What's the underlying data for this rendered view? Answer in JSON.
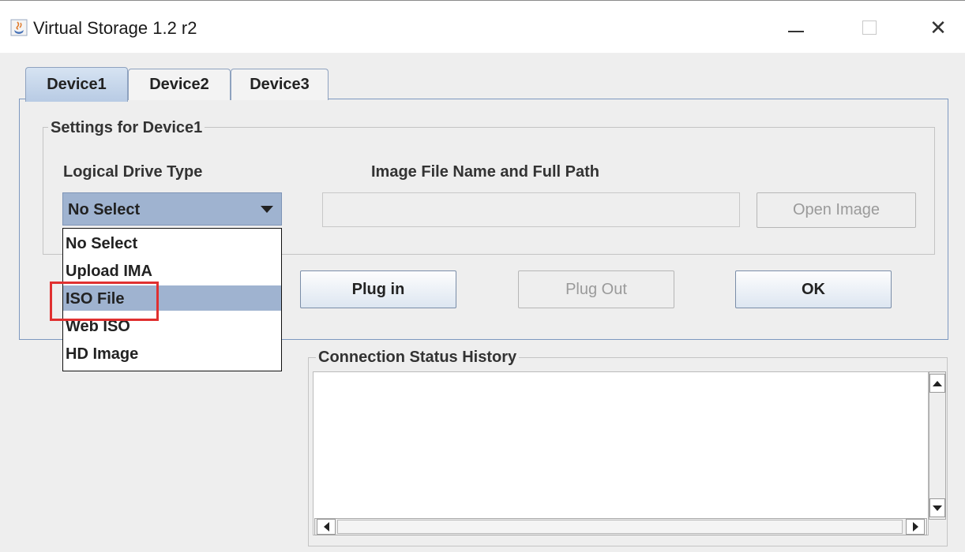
{
  "window": {
    "title": "Virtual Storage 1.2 r2",
    "icon": "java-cup-icon",
    "controls": {
      "minimize": "minimize-icon",
      "maximize": "maximize-icon",
      "close_symbol": "✕"
    }
  },
  "tabs": [
    {
      "label": "Device1",
      "active": true
    },
    {
      "label": "Device2",
      "active": false
    },
    {
      "label": "Device3",
      "active": false
    }
  ],
  "settings": {
    "group_title": "Settings for Device1",
    "drive_type_label": "Logical Drive Type",
    "drive_type_value": "No Select",
    "image_path_label": "Image File Name and Full Path",
    "image_path_value": "",
    "open_image_label": "Open Image",
    "open_image_enabled": false
  },
  "dropdown": {
    "open": true,
    "highlighted_index": 2,
    "options": [
      "No Select",
      "Upload IMA",
      "ISO File",
      "Web ISO",
      "HD Image"
    ]
  },
  "actions": {
    "plug_in_label": "Plug in",
    "plug_out_label": "Plug Out",
    "plug_out_enabled": false,
    "ok_label": "OK"
  },
  "status": {
    "group_title": "Connection Status History",
    "content": ""
  },
  "colors": {
    "selection": "#9fb3d0",
    "annotation_box": "#e03030",
    "panel_border": "#7d98c0"
  }
}
